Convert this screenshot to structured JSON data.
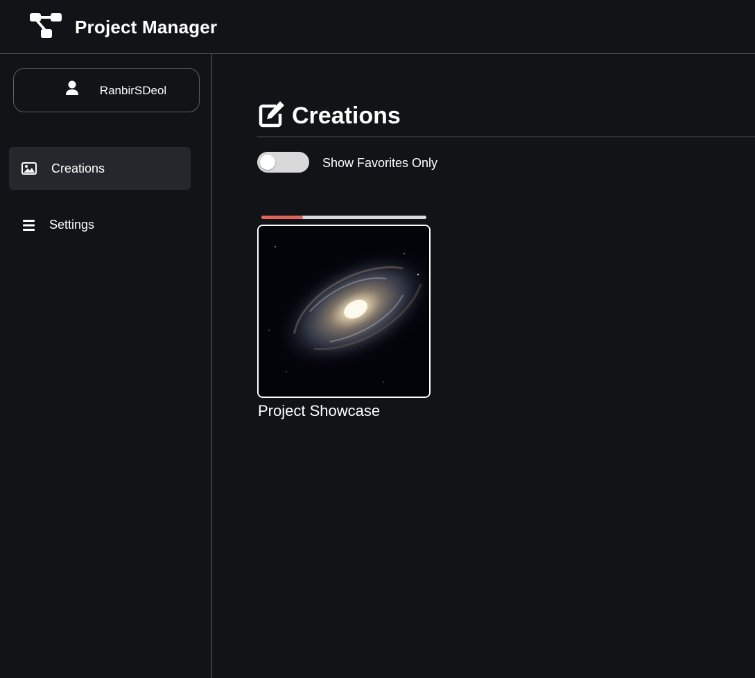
{
  "app": {
    "title": "Project Manager",
    "logo_icon": "project-tree-icon"
  },
  "user": {
    "name": "RanbirSDeol",
    "icon": "user-icon"
  },
  "sidebar": {
    "items": [
      {
        "label": "Creations",
        "icon": "image-icon",
        "active": true
      },
      {
        "label": "Settings",
        "icon": "menu-icon",
        "active": false
      }
    ]
  },
  "main": {
    "title": "Creations",
    "title_icon": "edit-icon",
    "favorites_toggle": {
      "label": "Show Favorites Only",
      "on": false
    },
    "projects": [
      {
        "title": "Project Showcase",
        "progress": 0.25,
        "thumbnail": "spiral-galaxy"
      }
    ]
  },
  "colors": {
    "background": "#121317",
    "active_nav": "#26272d",
    "border": "#5a5b60",
    "progress_fill": "#e0635a",
    "progress_track": "#d9d9d9"
  }
}
